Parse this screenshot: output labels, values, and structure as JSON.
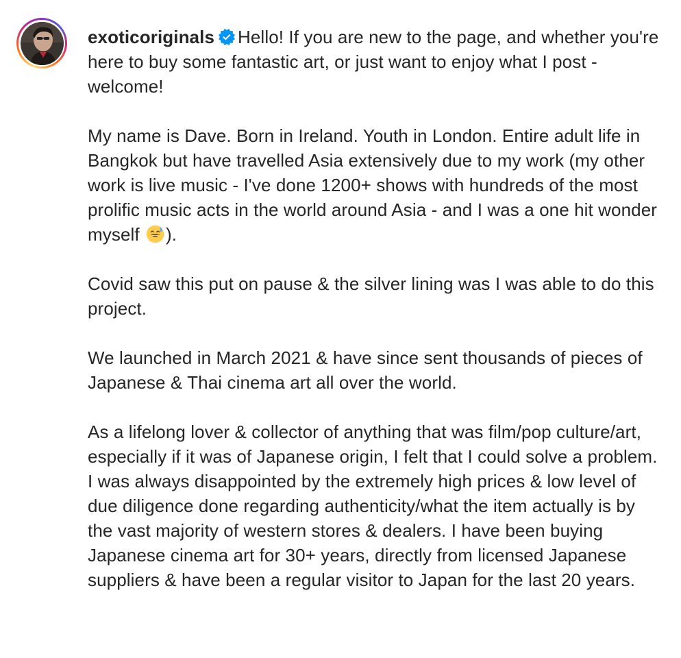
{
  "post": {
    "username": "exoticoriginals",
    "verified_icon": "verified-badge-icon",
    "avatar_icon": "profile-avatar",
    "intro": "Hello! If you are new to the page, and whether you're here to buy some fantastic art, or just want to enjoy what I post - welcome!",
    "paragraph_2_before_emoji": "My name is Dave. Born in Ireland. Youth in London. Entire adult life in Bangkok but have travelled Asia extensively due to my work (my other work is live music - I've done 1200+ shows with hundreds of the most prolific music acts in the world around Asia - and I was a one hit wonder myself",
    "emoji_icon": "grinning-sweat-emoji",
    "paragraph_2_after_emoji": ").",
    "paragraph_3": "Covid saw this put on pause & the silver lining was I was able to do this project.",
    "paragraph_4": "We launched in March 2021 & have since sent thousands of pieces of Japanese & Thai cinema art all over the world.",
    "paragraph_5": "As a lifelong lover & collector of anything that was film/pop culture/art, especially if it was of Japanese origin, I felt that I could solve a problem. I was always disappointed by the extremely high prices & low level of due diligence done regarding authenticity/what the item actually is by the vast majority of western stores & dealers. I have been buying Japanese cinema art for 30+ years, directly from licensed Japanese suppliers & have been a regular visitor to Japan for the last 20 years."
  },
  "colors": {
    "text": "#262626",
    "verified_blue": "#0095f6",
    "background": "#ffffff"
  }
}
